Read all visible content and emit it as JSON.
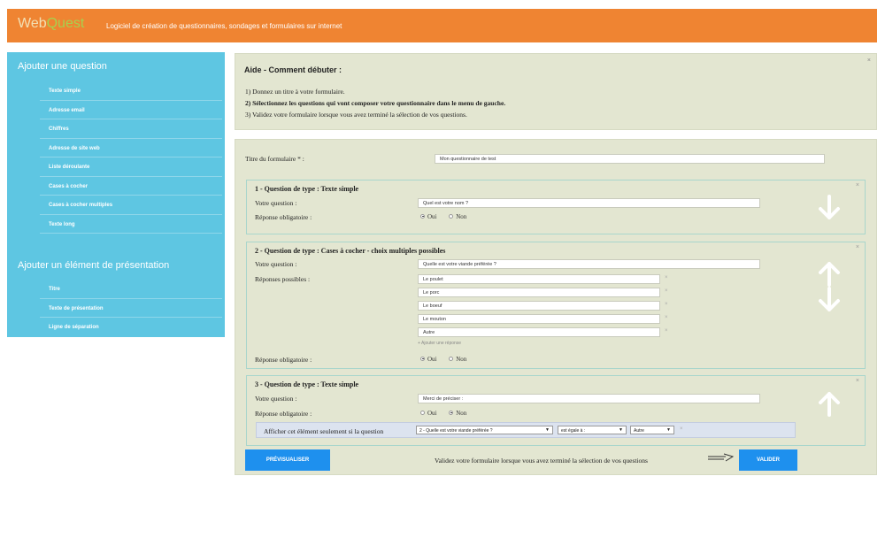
{
  "header": {
    "logo_web": "Web",
    "logo_quest": "Quest",
    "tagline": "Logiciel de création de questionnaires, sondages et formulaires sur internet",
    "bg_color": "#ef8432"
  },
  "sidebar": {
    "bg_color": "#5ec6e2",
    "questions_title": "Ajouter une question",
    "question_items": [
      "Texte simple",
      "Adresse email",
      "Chiffres",
      "Adresse de site web",
      "Liste déroulante",
      "Cases à cocher",
      "Cases à cocher multiples",
      "Texte long"
    ],
    "presentation_title": "Ajouter un élément de présentation",
    "presentation_items": [
      "Titre",
      "Texte de présentation",
      "Ligne de séparation"
    ]
  },
  "help": {
    "title": "Aide - Comment débuter :",
    "lines": [
      "1) Donnez un titre à votre formulaire.",
      "2) Sélectionnez les questions qui vont composer votre questionnaire dans le menu de gauche.",
      "3) Validez votre formulaire lorsque vous avez terminé la sélection de vos questions."
    ],
    "close": "×"
  },
  "form": {
    "title_label": "Titre du formulaire * :",
    "title_value": "Mon questionnaire de test",
    "q1": {
      "title": "1 - Question de type : Texte simple",
      "question_label": "Votre question :",
      "question_value": "Quel est votre nom ?",
      "required_label": "Réponse obligatoire :",
      "yes": "Oui",
      "no": "Non",
      "required": "Oui"
    },
    "q2": {
      "title": "2 - Question de type : Cases à cocher - choix multiples possibles",
      "question_label": "Votre question :",
      "question_value": "Quelle est votre viande préférée ?",
      "answers_label": "Réponses possibles :",
      "answers": [
        "Le poulet",
        "Le porc",
        "Le boeuf",
        "Le mouton",
        "Autre"
      ],
      "add_answer": "+ Ajouter une réponse",
      "required_label": "Réponse obligatoire :",
      "yes": "Oui",
      "no": "Non",
      "required": "Oui"
    },
    "q3": {
      "title": "3 - Question de type : Texte simple",
      "question_label": "Votre question :",
      "question_value": "Merci de préciser :",
      "required_label": "Réponse obligatoire :",
      "yes": "Oui",
      "no": "Non",
      "required": "Non",
      "condition_label": "Afficher cet élément seulement si la question",
      "condition_question": "2 - Quelle est votre viande préférée ?",
      "condition_operator": "est égale à :",
      "condition_value": "Autre"
    },
    "preview_button": "PRÉVISUALISER",
    "validate_text": "Validez votre formulaire lorsque vous avez terminé la sélection de vos questions",
    "validate_button": "VALIDER",
    "button_color": "#1e90ee"
  }
}
